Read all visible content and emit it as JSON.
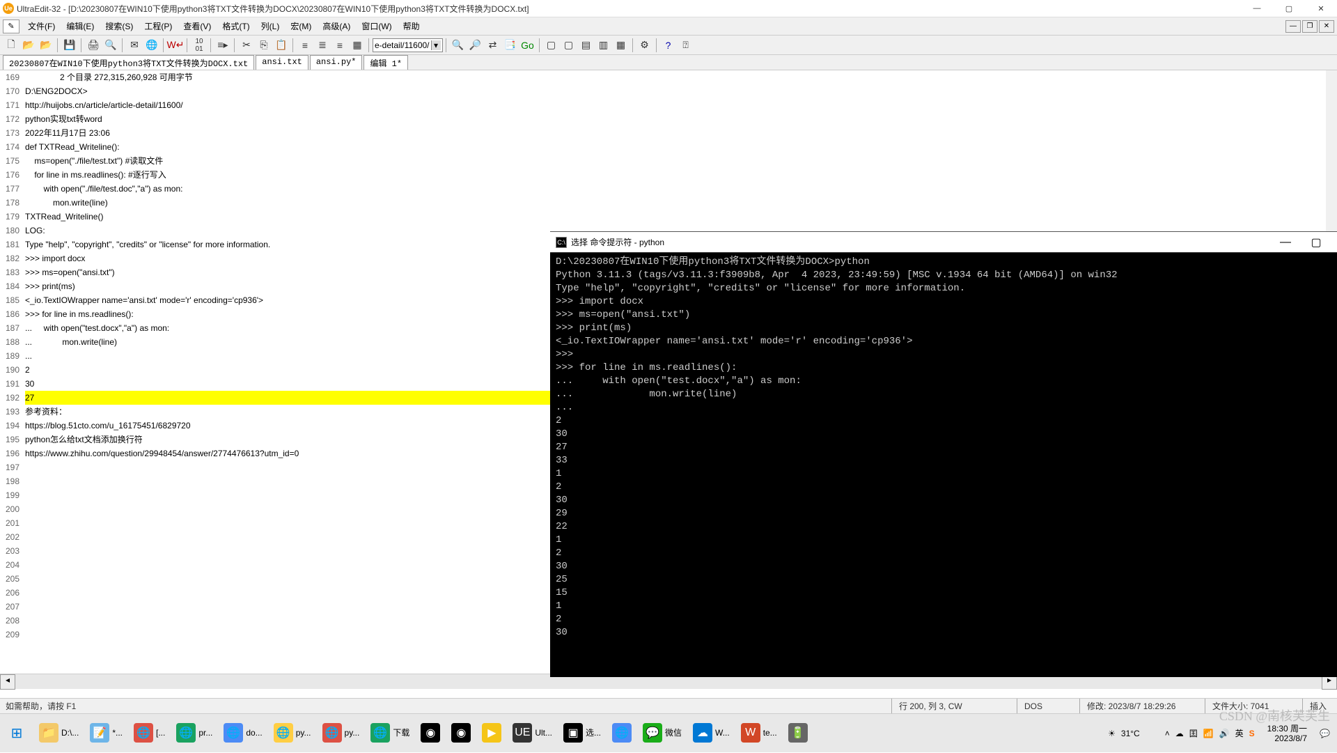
{
  "title": "UltraEdit-32 - [D:\\20230807在WIN10下使用python3将TXT文件转换为DOCX\\20230807在WIN10下使用python3将TXT文件转换为DOCX.txt]",
  "menus": [
    "文件(F)",
    "编辑(E)",
    "搜索(S)",
    "工程(P)",
    "查看(V)",
    "格式(T)",
    "列(L)",
    "宏(M)",
    "高级(A)",
    "窗口(W)",
    "帮助"
  ],
  "combo": "e-detail/11600/",
  "tabs": [
    "20230807在WIN10下使用python3将TXT文件转换为DOCX.txt",
    "ansi.txt",
    "ansi.py*",
    "编辑 1*"
  ],
  "gutter_start": 169,
  "code_lines": [
    "               2 个目录 272,315,260,928 可用字节",
    "",
    "D:\\ENG2DOCX>",
    "",
    "",
    "",
    "",
    "http://huijobs.cn/article/article-detail/11600/",
    "python实现txt转word",
    "2022年11月17日 23:06",
    "",
    "def TXTRead_Writeline():",
    "    ms=open(\"./file/test.txt\") #读取文件",
    "    for line in ms.readlines(): #逐行写入",
    "        with open(\"./file/test.doc\",\"a\") as mon:",
    "            mon.write(line)",
    "TXTRead_Writeline()",
    "",
    "",
    "LOG:",
    "Type \"help\", \"copyright\", \"credits\" or \"license\" for more information.",
    ">>> import docx",
    ">>> ms=open(\"ansi.txt\")",
    ">>> print(ms)",
    "<_io.TextIOWrapper name='ansi.txt' mode='r' encoding='cp936'>",
    ">>> for line in ms.readlines():",
    "...     with open(\"test.docx\",\"a\") as mon:",
    "...             mon.write(line)",
    "...",
    "2",
    "30",
    "27",
    "",
    "",
    "",
    "参考资料：",
    "https://blog.51cto.com/u_16175451/6829720",
    "python怎么给txt文档添加换行符",
    "",
    "",
    "https://www.zhihu.com/question/29948454/answer/2774476613?utm_id=0"
  ],
  "highlight_line_index": 31,
  "console_title": "选择 命令提示符 - python",
  "console_lines": [
    "D:\\20230807在WIN10下使用python3将TXT文件转换为DOCX>python",
    "Python 3.11.3 (tags/v3.11.3:f3909b8, Apr  4 2023, 23:49:59) [MSC v.1934 64 bit (AMD64)] on win32",
    "Type \"help\", \"copyright\", \"credits\" or \"license\" for more information.",
    ">>> import docx",
    ">>> ms=open(\"ansi.txt\")",
    ">>> print(ms)",
    "<_io.TextIOWrapper name='ansi.txt' mode='r' encoding='cp936'>",
    ">>>",
    ">>> for line in ms.readlines():",
    "...     with open(\"test.docx\",\"a\") as mon:",
    "...             mon.write(line)",
    "...",
    "2",
    "30",
    "27",
    "33",
    "1",
    "2",
    "30",
    "29",
    "22",
    "1",
    "2",
    "30",
    "25",
    "15",
    "1",
    "2",
    "30"
  ],
  "status": {
    "help": "如需帮助，请按 F1",
    "pos": "行 200, 列 3, CW",
    "encoding": "DOS",
    "modified": "修改: 2023/8/7 18:29:26",
    "filesize": "文件大小: 7041",
    "mode": "插入"
  },
  "taskbar_items": [
    {
      "icon": "📁",
      "label": "D:\\...",
      "color": "#f3c969"
    },
    {
      "icon": "📝",
      "label": "*...",
      "color": "#6db5e8"
    },
    {
      "icon": "🌐",
      "label": "[...",
      "color": "#dd5144"
    },
    {
      "icon": "🌐",
      "label": "pr...",
      "color": "#1aa260"
    },
    {
      "icon": "🌐",
      "label": "do...",
      "color": "#4c8bf5"
    },
    {
      "icon": "🌐",
      "label": "py...",
      "color": "#ffce44"
    },
    {
      "icon": "🌐",
      "label": "py...",
      "color": "#dd5144"
    },
    {
      "icon": "🌐",
      "label": "下载",
      "color": "#1aa260"
    },
    {
      "icon": "◉",
      "label": "",
      "color": "#000"
    },
    {
      "icon": "◉",
      "label": "",
      "color": "#000"
    },
    {
      "icon": "▶",
      "label": "",
      "color": "#f5c518"
    },
    {
      "icon": "UE",
      "label": "Ult...",
      "color": "#333"
    },
    {
      "icon": "▣",
      "label": "选...",
      "color": "#000"
    },
    {
      "icon": "🌐",
      "label": "",
      "color": "#4c8bf5"
    },
    {
      "icon": "💬",
      "label": "微信",
      "color": "#1aad19"
    },
    {
      "icon": "☁",
      "label": "W...",
      "color": "#0078d4"
    },
    {
      "icon": "W",
      "label": "te...",
      "color": "#d24726"
    },
    {
      "icon": "🔋",
      "label": "",
      "color": "#666"
    }
  ],
  "tray": {
    "temp": "31°C",
    "time": "18:30 周一",
    "date": "2023/8/7"
  },
  "watermark": "CSDN @南核芙芙生"
}
